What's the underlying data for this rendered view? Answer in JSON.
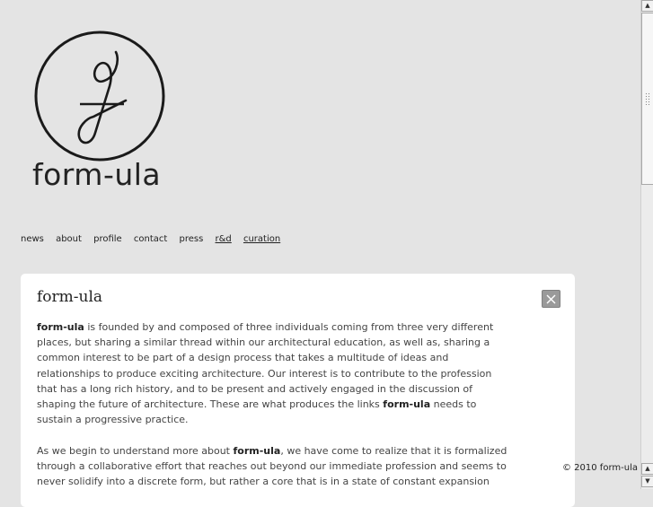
{
  "logo": {
    "icon": "formula-f-circle-icon",
    "wordmark": "form-ula"
  },
  "nav": {
    "items": [
      "news",
      "about",
      "profile",
      "contact",
      "press",
      "r&d",
      "curation"
    ]
  },
  "panel": {
    "title": "form-ula",
    "close_icon": "close-icon",
    "paragraph1": {
      "brand": "form-ula",
      "text_a": " is founded by and composed of three individuals coming from three very different places, but sharing a similar thread within our architectural education, as well as, sharing a common interest to be part of a design process that takes a multitude of ideas and relationships to produce exciting architecture.  Our interest is to contribute to the profession that has a long rich history, and to be present and actively engaged in the discussion of shaping the future of architecture. These are what produces the links ",
      "brand2": "form-ula",
      "text_b": " needs to sustain a progressive practice."
    },
    "paragraph2": {
      "text_a": "As we begin to understand more about ",
      "brand": "form-ula",
      "text_b": ", we have come to realize that it is formalized through a collaborative effort that reaches out beyond our immediate profession and seems to never solidify into a discrete form, but rather a core that is in a state of constant expansion"
    }
  },
  "footer": {
    "copyright": "© 2010 form-ula"
  },
  "colors": {
    "background": "#e4e4e4",
    "panel": "#ffffff",
    "close_button": "#9a9a9a"
  }
}
